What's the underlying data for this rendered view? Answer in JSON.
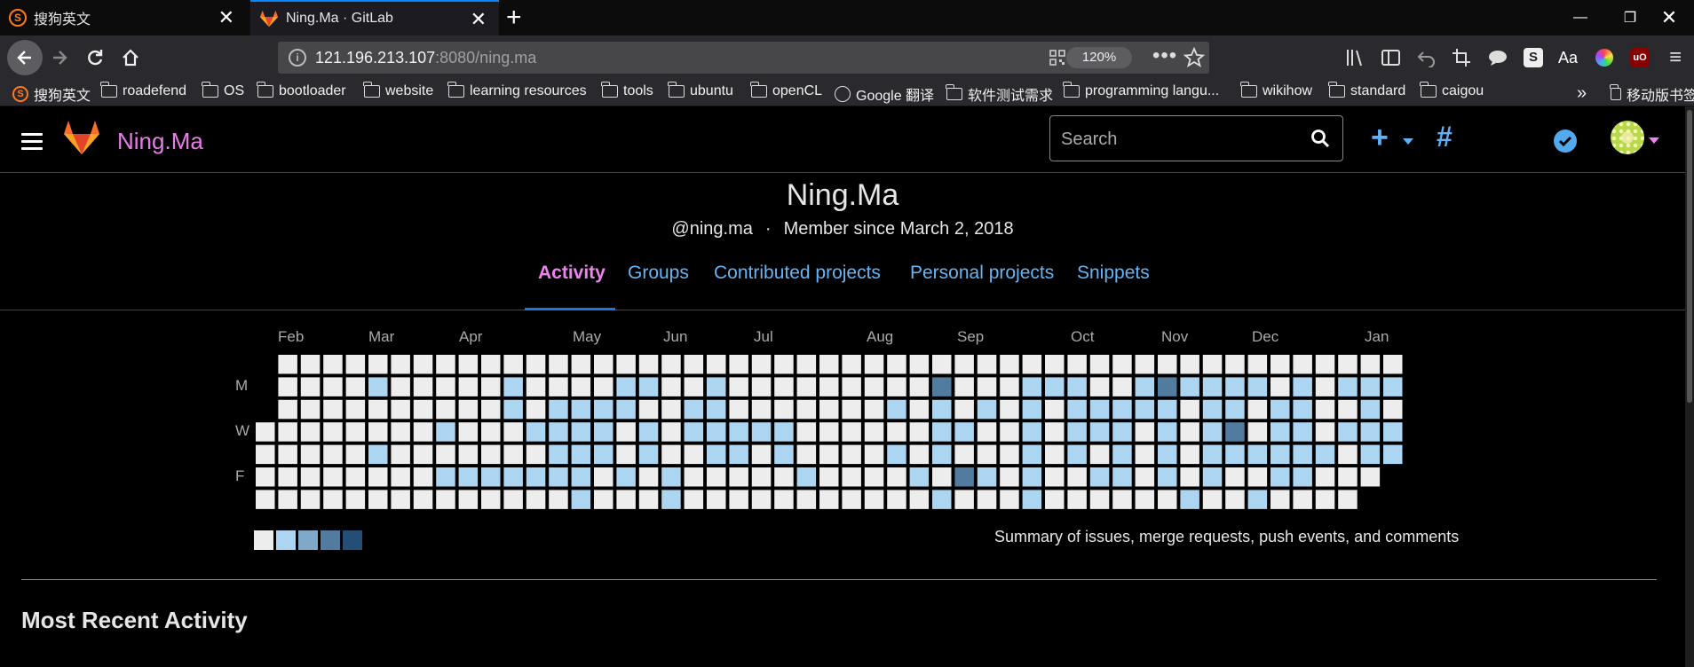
{
  "browser": {
    "tabs": [
      {
        "title": "搜狗英文",
        "active": false
      },
      {
        "title": "Ning.Ma · GitLab",
        "active": true
      }
    ],
    "url_host": "121.196.213.107",
    "url_rest": ":8080/ning.ma",
    "zoom": "120%",
    "bookmarks": [
      {
        "label": "搜狗英文",
        "icon": "sogou-icon"
      },
      {
        "label": "roadefend",
        "icon": "folder-icon"
      },
      {
        "label": "OS",
        "icon": "folder-icon"
      },
      {
        "label": "bootloader",
        "icon": "folder-icon"
      },
      {
        "label": "website",
        "icon": "folder-icon"
      },
      {
        "label": "learning resources",
        "icon": "folder-icon"
      },
      {
        "label": "tools",
        "icon": "folder-icon"
      },
      {
        "label": "ubuntu",
        "icon": "folder-icon"
      },
      {
        "label": "openCL",
        "icon": "folder-icon"
      },
      {
        "label": "Google 翻译",
        "icon": "globe-icon"
      },
      {
        "label": "软件测试需求",
        "icon": "folder-icon"
      },
      {
        "label": "programming langu...",
        "icon": "folder-icon"
      },
      {
        "label": "wikihow",
        "icon": "folder-icon"
      },
      {
        "label": "standard",
        "icon": "folder-icon"
      },
      {
        "label": "caigou",
        "icon": "folder-icon"
      }
    ],
    "mobile_bookmarks": "移动版书签"
  },
  "header": {
    "brand": "Ning.Ma",
    "search_placeholder": "Search"
  },
  "profile": {
    "name": "Ning.Ma",
    "username": "@ning.ma",
    "separator": "·",
    "member_since": "Member since March 2, 2018",
    "tabs": [
      "Activity",
      "Groups",
      "Contributed projects",
      "Personal projects",
      "Snippets"
    ],
    "active_tab": "Activity"
  },
  "calendar": {
    "months": [
      "Feb",
      "Mar",
      "Apr",
      "May",
      "Jun",
      "Jul",
      "Aug",
      "Sep",
      "Oct",
      "Nov",
      "Dec",
      "Jan"
    ],
    "day_labels": [
      "M",
      "W",
      "F"
    ],
    "level_colors": [
      "#ededed",
      "#acd5f2",
      "#7fa8c9",
      "#527ba0",
      "#254e77"
    ],
    "activity_levels": {
      "week_count": 53,
      "note": "levels per week (Sun..Sat); 0 = none",
      "weeks": [
        [
          -1,
          -1,
          -1,
          0,
          0,
          0,
          0
        ],
        [
          0,
          0,
          0,
          0,
          0,
          0,
          0
        ],
        [
          0,
          0,
          0,
          0,
          0,
          0,
          0
        ],
        [
          0,
          0,
          0,
          0,
          0,
          0,
          0
        ],
        [
          0,
          0,
          0,
          0,
          0,
          0,
          0
        ],
        [
          0,
          1,
          0,
          0,
          1,
          0,
          0
        ],
        [
          0,
          0,
          0,
          0,
          0,
          0,
          0
        ],
        [
          0,
          0,
          0,
          0,
          0,
          0,
          0
        ],
        [
          0,
          0,
          0,
          1,
          0,
          1,
          0
        ],
        [
          0,
          0,
          0,
          0,
          0,
          1,
          0
        ],
        [
          0,
          0,
          0,
          0,
          0,
          1,
          0
        ],
        [
          0,
          1,
          1,
          0,
          0,
          1,
          0
        ],
        [
          0,
          0,
          0,
          1,
          0,
          1,
          0
        ],
        [
          0,
          0,
          1,
          1,
          1,
          1,
          0
        ],
        [
          0,
          0,
          1,
          1,
          1,
          1,
          1
        ],
        [
          0,
          0,
          1,
          1,
          1,
          0,
          0
        ],
        [
          0,
          1,
          1,
          0,
          0,
          1,
          0
        ],
        [
          0,
          1,
          0,
          1,
          1,
          0,
          0
        ],
        [
          0,
          0,
          0,
          0,
          0,
          1,
          1
        ],
        [
          0,
          0,
          1,
          1,
          0,
          0,
          0
        ],
        [
          0,
          1,
          1,
          1,
          1,
          0,
          0
        ],
        [
          0,
          0,
          0,
          1,
          1,
          0,
          0
        ],
        [
          0,
          0,
          0,
          1,
          0,
          0,
          0
        ],
        [
          0,
          0,
          0,
          1,
          1,
          0,
          0
        ],
        [
          0,
          0,
          0,
          0,
          0,
          1,
          0
        ],
        [
          0,
          0,
          0,
          0,
          0,
          0,
          0
        ],
        [
          0,
          0,
          0,
          0,
          0,
          0,
          0
        ],
        [
          0,
          0,
          0,
          0,
          0,
          0,
          0
        ],
        [
          0,
          0,
          1,
          0,
          1,
          0,
          0
        ],
        [
          0,
          0,
          0,
          0,
          0,
          1,
          0
        ],
        [
          0,
          3,
          1,
          1,
          1,
          0,
          1
        ],
        [
          0,
          0,
          0,
          1,
          0,
          3,
          0
        ],
        [
          0,
          0,
          1,
          0,
          0,
          1,
          0
        ],
        [
          0,
          0,
          0,
          0,
          0,
          0,
          0
        ],
        [
          0,
          1,
          1,
          1,
          1,
          1,
          1
        ],
        [
          0,
          1,
          0,
          0,
          0,
          0,
          0
        ],
        [
          0,
          1,
          1,
          1,
          1,
          0,
          0
        ],
        [
          0,
          0,
          1,
          1,
          0,
          1,
          0
        ],
        [
          0,
          0,
          1,
          1,
          1,
          1,
          0
        ],
        [
          0,
          1,
          1,
          0,
          0,
          0,
          0
        ],
        [
          0,
          3,
          1,
          1,
          1,
          1,
          0
        ],
        [
          0,
          1,
          0,
          0,
          0,
          0,
          1
        ],
        [
          0,
          1,
          1,
          1,
          1,
          1,
          0
        ],
        [
          0,
          1,
          1,
          3,
          1,
          0,
          0
        ],
        [
          0,
          1,
          0,
          0,
          1,
          0,
          1
        ],
        [
          0,
          0,
          1,
          1,
          1,
          1,
          0
        ],
        [
          0,
          1,
          1,
          1,
          1,
          1,
          0
        ],
        [
          0,
          0,
          0,
          0,
          1,
          0,
          0
        ],
        [
          0,
          1,
          0,
          1,
          0,
          0,
          0
        ],
        [
          0,
          1,
          1,
          1,
          1,
          0,
          -1
        ],
        [
          0,
          1,
          0,
          1,
          1,
          -1,
          -1
        ]
      ]
    },
    "summary": "Summary of issues, merge requests, push events, and comments"
  },
  "recent": {
    "heading": "Most Recent Activity"
  }
}
